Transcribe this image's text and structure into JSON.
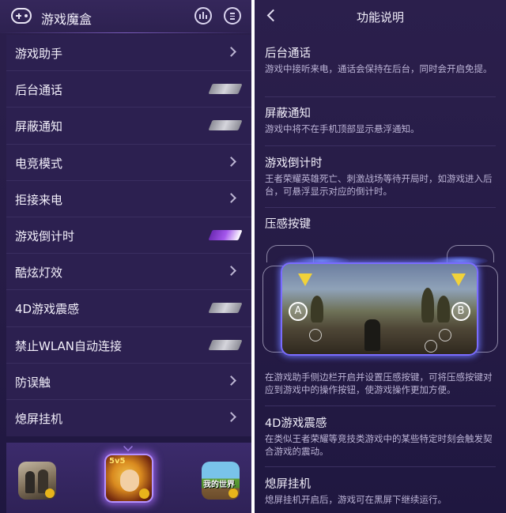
{
  "left": {
    "header": {
      "title": "游戏魔盒",
      "icons": [
        "gamepad-icon",
        "stats-icon",
        "document-icon"
      ]
    },
    "menu": [
      {
        "label": "游戏助手",
        "control": "chevron"
      },
      {
        "label": "后台通话",
        "control": "toggle",
        "on": false
      },
      {
        "label": "屏蔽通知",
        "control": "toggle",
        "on": false
      },
      {
        "label": "电竞模式",
        "control": "chevron"
      },
      {
        "label": "拒接来电",
        "control": "chevron"
      },
      {
        "label": "游戏倒计时",
        "control": "toggle",
        "on": true
      },
      {
        "label": "酷炫灯效",
        "control": "chevron"
      },
      {
        "label": "4D游戏震感",
        "control": "toggle",
        "on": false
      },
      {
        "label": "禁止WLAN自动连接",
        "control": "toggle",
        "on": false
      },
      {
        "label": "防误触",
        "control": "chevron"
      },
      {
        "label": "熄屏挂机",
        "control": "chevron"
      }
    ],
    "dock": {
      "games": [
        {
          "icon": "pubg-game-icon"
        },
        {
          "icon": "honor-of-kings-game-icon",
          "badge": "5v5",
          "selected": true
        },
        {
          "icon": "minecraft-game-icon",
          "text": "我的世界"
        }
      ]
    }
  },
  "right": {
    "header": {
      "title": "功能说明",
      "back_icon": "back-icon"
    },
    "sections": [
      {
        "title": "后台通话",
        "desc": "游戏中接听来电，通话会保持在后台，同时会开启免提。"
      },
      {
        "title": "屏蔽通知",
        "desc": "游戏中将不在手机顶部显示悬浮通知。"
      },
      {
        "title": "游戏倒计时",
        "desc": "王者荣耀英雄死亡、刺激战场等待开局时，如游戏进入后台，可悬浮显示对应的倒计时。"
      },
      {
        "title": "压感按键",
        "desc": "在游戏助手侧边栏开启并设置压感按键，可将压感按键对应到游戏中的操作按钮，使游戏操作更加方便。"
      },
      {
        "title": "4D游戏震感",
        "desc": "在类似王者荣耀等竞技类游戏中的某些特定时刻会触发契合游戏的震动。"
      },
      {
        "title": "熄屏挂机",
        "desc": "熄屏挂机开启后，游戏可在黑屏下继续运行。"
      }
    ],
    "illustration": {
      "button_a": "A",
      "button_b": "B"
    }
  },
  "colors": {
    "background": "#271c48",
    "accent": "#a457ec",
    "text": "#f3f0fb",
    "secondary_text": "#bcb4d6"
  }
}
